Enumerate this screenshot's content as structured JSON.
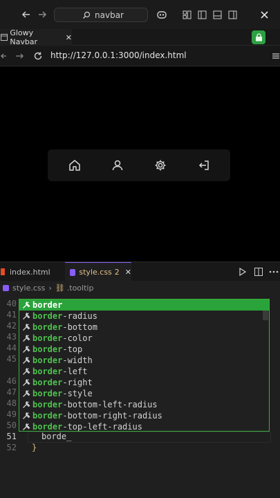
{
  "titlebar": {
    "search_text": "navbar"
  },
  "browser_tab": {
    "title": "Glowy Navbar",
    "close": "✕"
  },
  "urlbar": {
    "url": "http://127.0.0.1:3000/index.html"
  },
  "editor_tabs": [
    {
      "label": "index.html"
    },
    {
      "label": "style.css",
      "badge": "2",
      "close": "✕"
    }
  ],
  "breadcrumb": {
    "file": "style.css",
    "sep": "›",
    "symbol": ".tooltip"
  },
  "line_numbers": [
    "40",
    "41",
    "42",
    "43",
    "44",
    "45",
    "46",
    "47",
    "48",
    "49",
    "50",
    "51",
    "52"
  ],
  "code": {
    "line51": "borde_",
    "line52": "}"
  },
  "suggestions": [
    {
      "match": "border",
      "rest": ""
    },
    {
      "match": "border",
      "rest": "-radius"
    },
    {
      "match": "border",
      "rest": "-bottom"
    },
    {
      "match": "border",
      "rest": "-color"
    },
    {
      "match": "border",
      "rest": "-top"
    },
    {
      "match": "border",
      "rest": "-width"
    },
    {
      "match": "border",
      "rest": "-left"
    },
    {
      "match": "border",
      "rest": "-right"
    },
    {
      "match": "border",
      "rest": "-style"
    },
    {
      "match": "border",
      "rest": "-bottom-left-radius"
    },
    {
      "match": "border",
      "rest": "-bottom-right-radius"
    },
    {
      "match": "border",
      "rest": "-top-left-radius"
    }
  ],
  "icons": [
    "back-icon",
    "forward-icon",
    "search-icon",
    "copilot-icon",
    "layout-icon",
    "sidebar-icon",
    "panel-icon",
    "secondary-sidebar-icon",
    "close-icon",
    "browser-tab-icon",
    "lock-icon",
    "reload-icon",
    "menu-icon",
    "home-icon",
    "user-icon",
    "gear-icon",
    "logout-icon",
    "run-icon",
    "split-icon",
    "more-icon",
    "wrench-icon"
  ],
  "colors": {
    "accent_green": "#2aa33a",
    "suggest_border": "#3fae3f",
    "active_tab_accent": "#8a5cf6",
    "css_file": "#e2c08d"
  }
}
